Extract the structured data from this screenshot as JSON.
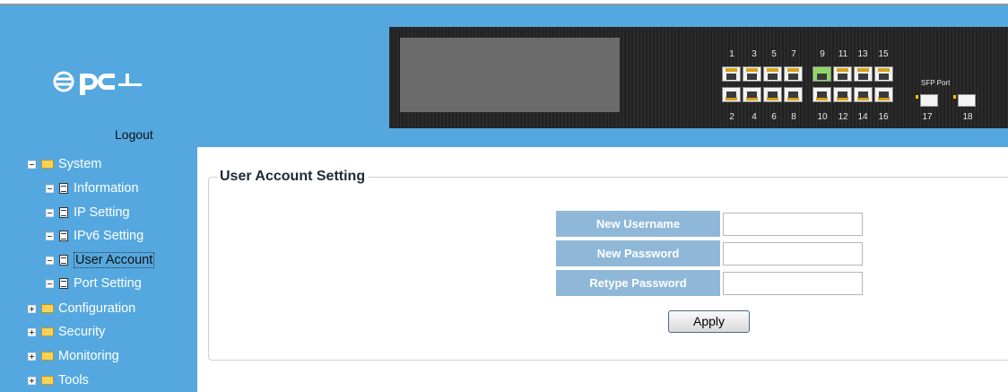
{
  "header": {
    "logout_label": "Logout",
    "brand_color": "#55a8df",
    "logo_icon": "pci-logo"
  },
  "switch_panel": {
    "top_ports": [
      "1",
      "3",
      "5",
      "7",
      "9",
      "11",
      "13",
      "15"
    ],
    "bottom_ports": [
      "2",
      "4",
      "6",
      "8",
      "10",
      "12",
      "14",
      "16"
    ],
    "sfp_label": "SFP Port",
    "sfp_ports": [
      "17",
      "18"
    ],
    "active_port": "9"
  },
  "sidebar": {
    "items": [
      {
        "label": "System",
        "icon": "folder-open-icon",
        "toggle": "minus"
      },
      {
        "label": "Information",
        "icon": "document-icon",
        "toggle": "minus"
      },
      {
        "label": "IP Setting",
        "icon": "document-icon",
        "toggle": "minus"
      },
      {
        "label": "IPv6 Setting",
        "icon": "document-icon",
        "toggle": "minus"
      },
      {
        "label": "User Account",
        "icon": "document-icon",
        "toggle": "minus",
        "selected": true
      },
      {
        "label": "Port Setting",
        "icon": "document-icon",
        "toggle": "minus"
      },
      {
        "label": "Configuration",
        "icon": "folder-icon",
        "toggle": "plus"
      },
      {
        "label": "Security",
        "icon": "folder-icon",
        "toggle": "plus"
      },
      {
        "label": "Monitoring",
        "icon": "folder-icon",
        "toggle": "plus"
      },
      {
        "label": "Tools",
        "icon": "folder-icon",
        "toggle": "plus"
      }
    ]
  },
  "main": {
    "section_title": "User Account Setting",
    "form": {
      "username_label": "New Username",
      "username_value": "",
      "password_label": "New Password",
      "password_value": "",
      "retype_label": "Retype Password",
      "retype_value": "",
      "apply_label": "Apply"
    }
  }
}
